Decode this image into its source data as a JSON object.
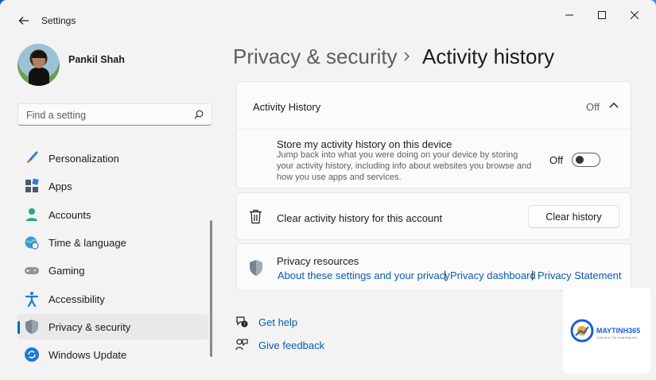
{
  "window": {
    "title": "Settings"
  },
  "user": {
    "name": "Pankil Shah"
  },
  "search": {
    "placeholder": "Find a setting"
  },
  "nav": {
    "items": [
      {
        "label": "Personalization"
      },
      {
        "label": "Apps"
      },
      {
        "label": "Accounts"
      },
      {
        "label": "Time & language"
      },
      {
        "label": "Gaming"
      },
      {
        "label": "Accessibility"
      },
      {
        "label": "Privacy & security"
      },
      {
        "label": "Windows Update"
      }
    ]
  },
  "header": {
    "breadcrumb": "Privacy & security",
    "title": "Activity history"
  },
  "activity_history": {
    "section_label": "Activity History",
    "section_state": "Off",
    "store_title": "Store my activity history on this device",
    "store_desc_line1": "Jump back into what you were doing on your device by storing",
    "store_desc_line2": "your activity history, including info about websites you browse and",
    "store_desc_line3": "how you use apps and services.",
    "toggle_state": "Off"
  },
  "clear_history": {
    "label": "Clear activity history for this account",
    "button": "Clear history"
  },
  "privacy_resources": {
    "title": "Privacy resources",
    "links": [
      "About these settings and your privacy",
      "Privacy dashboard",
      "Privacy Statement"
    ],
    "separator": "|"
  },
  "footer": {
    "get_help": "Get help",
    "give_feedback": "Give feedback"
  },
  "watermark": {
    "brand": "MAYTINH365",
    "tagline": "Chia sẻ & Thủ thuật Máy tính"
  },
  "colors": {
    "accent": "#0067c0",
    "link": "#0b5cad"
  }
}
